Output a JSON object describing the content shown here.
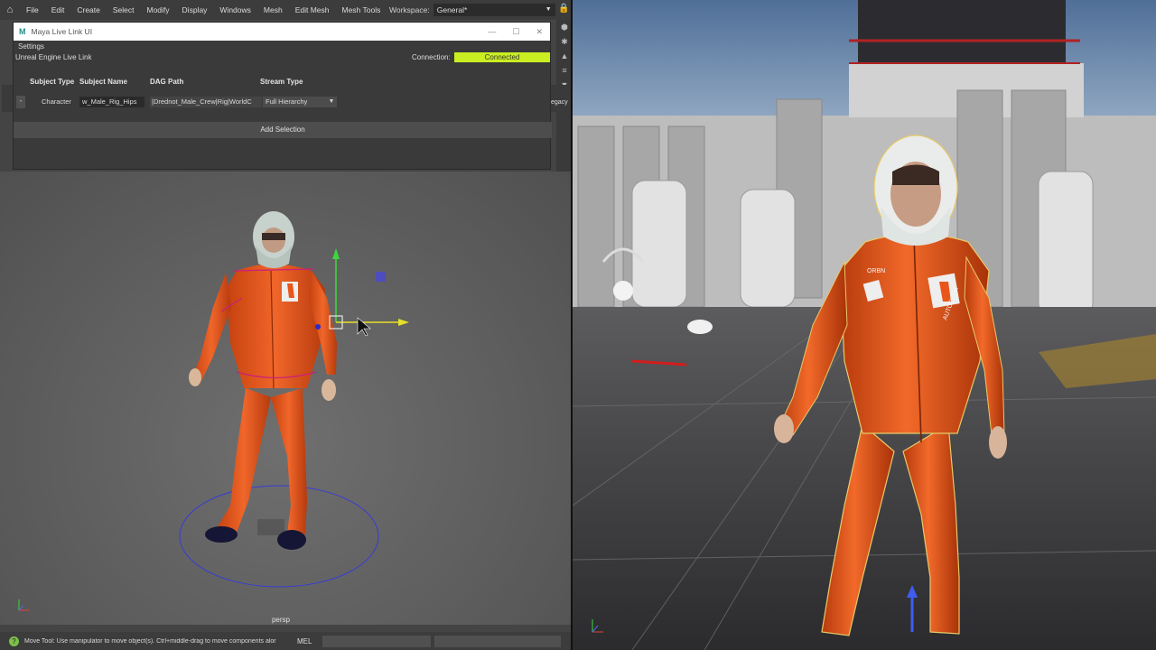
{
  "maya": {
    "menu": [
      "File",
      "Edit",
      "Create",
      "Select",
      "Modify",
      "Display",
      "Windows",
      "Mesh",
      "Edit Mesh",
      "Mesh Tools"
    ],
    "workspace_label": "Workspace:",
    "workspace_value": "General*",
    "viewport_label": "persp",
    "status_text": "Move Tool: Use manipulator to move object(s). Ctrl+middle-drag to move components alor",
    "command_language": "MEL",
    "side_clipped_text": "egacy"
  },
  "livelink": {
    "window_title": "Maya Live Link UI",
    "settings_label": "Settings",
    "header_label": "Unreal Engine Live Link",
    "connection_label": "Connection:",
    "connection_status": "Connected",
    "columns": {
      "subject_type": "Subject Type",
      "subject_name": "Subject Name",
      "dag_path": "DAG Path",
      "stream_type": "Stream Type"
    },
    "row": {
      "subject_type": "Character",
      "subject_name": "w_Male_Rig_Hips",
      "dag_path": "|Drednot_Male_Crew|Rig|WorldC",
      "stream_type": "Full Hierarchy"
    },
    "add_selection_label": "Add Selection"
  },
  "suit_logos": {
    "chest_left": "ORBN",
    "chest_right": "AUTODESK"
  },
  "colors": {
    "suit_orange": "#e8561a",
    "connected_green": "#c9ee22",
    "maya_bg": "#444444",
    "unreal_sky": "#9bb4d0"
  }
}
